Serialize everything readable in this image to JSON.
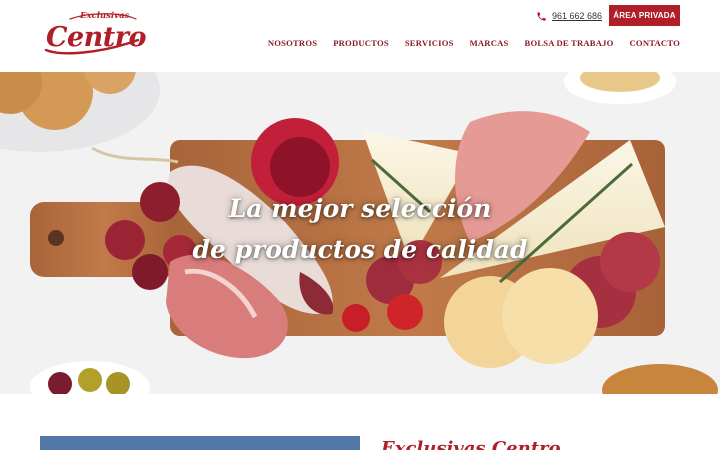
{
  "header": {
    "logo": {
      "top_word": "Exclusivas",
      "main_word": "Centro"
    },
    "phone": "961 662 686",
    "area_privada_label": "ÁREA PRIVADA",
    "nav": [
      "NOSOTROS",
      "PRODUCTOS",
      "SERVICIOS",
      "MARCAS",
      "BOLSA DE TRABAJO",
      "CONTACTO"
    ]
  },
  "hero": {
    "title_line_1": "La mejor selección",
    "title_line_2": "de productos de calidad"
  },
  "below": {
    "section_title": "Exclusivas Centro"
  },
  "colors": {
    "brand_red": "#b01e28",
    "nav_red": "#8e1a22",
    "image_blue": "#5478a6"
  },
  "icons": [
    "phone-icon"
  ]
}
